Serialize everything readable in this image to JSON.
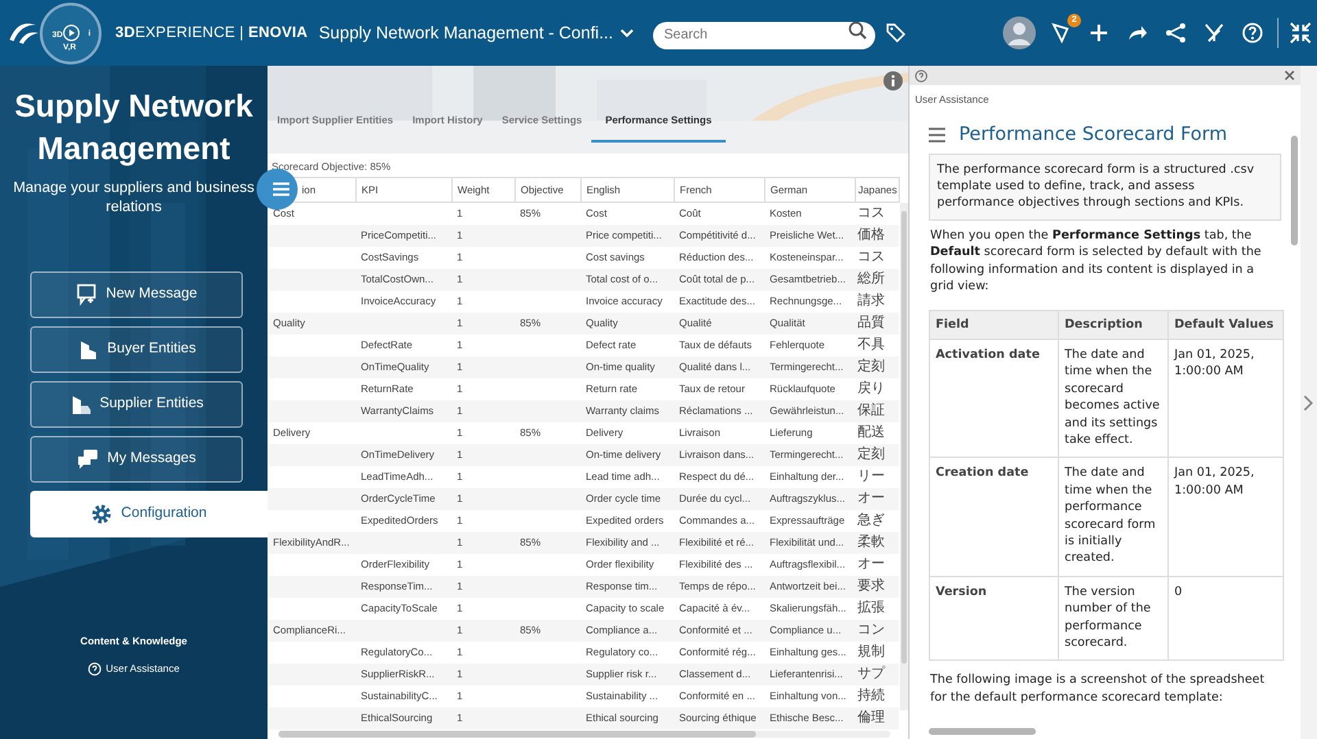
{
  "topbar": {
    "compass_labels": [
      "3D",
      "i",
      "V,R"
    ],
    "brand": "**3D**EXPERIENCE | **ENOVIA**",
    "app_title": "Supply Network Management - Confi...",
    "search": {
      "placeholder": "Search"
    },
    "notification_count": "2"
  },
  "sidebar": {
    "title": "Supply Network Management",
    "subtitle": "Manage your suppliers and business relations",
    "nav": [
      {
        "label": "New Message",
        "selected": false
      },
      {
        "label": "Buyer Entities",
        "selected": false
      },
      {
        "label": "Supplier Entities",
        "selected": false
      },
      {
        "label": "My Messages",
        "selected": false
      },
      {
        "label": "Configuration",
        "selected": true
      }
    ],
    "footer_heading": "Content & Knowledge",
    "footer_link": "User Assistance"
  },
  "tabs": [
    {
      "label": "Import Supplier Entities",
      "selected": false
    },
    {
      "label": "Import History",
      "selected": false
    },
    {
      "label": "Service Settings",
      "selected": false
    },
    {
      "label": "Performance Settings",
      "selected": true
    }
  ],
  "scorecard_objective": "Scorecard Objective: 85%",
  "table": {
    "columns": [
      "ion",
      "KPI",
      "Weight",
      "Objective",
      "English",
      "French",
      "German",
      "Japanes"
    ],
    "rows": [
      {
        "section": "Cost",
        "weight": "1",
        "objective": "85%",
        "english": "Cost",
        "french": "Coût",
        "german": "Kosten",
        "japanese": "コス"
      },
      {
        "kpi": "PriceCompetiti...",
        "weight": "1",
        "english": "Price competiti...",
        "french": "Compétitivité d...",
        "german": "Preisliche Wet...",
        "japanese": "価格"
      },
      {
        "kpi": "CostSavings",
        "weight": "1",
        "english": "Cost savings",
        "french": "Réduction des...",
        "german": "Kosteneinspar...",
        "japanese": "コス"
      },
      {
        "kpi": "TotalCostOwn...",
        "weight": "1",
        "english": "Total cost of o...",
        "french": "Coût total de p...",
        "german": "Gesamtbetrieb...",
        "japanese": "総所"
      },
      {
        "kpi": "InvoiceAccuracy",
        "weight": "1",
        "english": "Invoice accuracy",
        "french": "Exactitude des...",
        "german": "Rechnungsge...",
        "japanese": "請求"
      },
      {
        "section": "Quality",
        "weight": "1",
        "objective": "85%",
        "english": "Quality",
        "french": "Qualité",
        "german": "Qualität",
        "japanese": "品質"
      },
      {
        "kpi": "DefectRate",
        "weight": "1",
        "english": "Defect rate",
        "french": "Taux de défauts",
        "german": "Fehlerquote",
        "japanese": "不具"
      },
      {
        "kpi": "OnTimeQuality",
        "weight": "1",
        "english": "On-time quality",
        "french": "Qualité dans l...",
        "german": "Termingerecht...",
        "japanese": "定刻"
      },
      {
        "kpi": "ReturnRate",
        "weight": "1",
        "english": "Return rate",
        "french": "Taux de retour",
        "german": "Rücklaufquote",
        "japanese": "戻り"
      },
      {
        "kpi": "WarrantyClaims",
        "weight": "1",
        "english": "Warranty claims",
        "french": "Réclamations ...",
        "german": "Gewährleistun...",
        "japanese": "保証"
      },
      {
        "section": "Delivery",
        "weight": "1",
        "objective": "85%",
        "english": "Delivery",
        "french": "Livraison",
        "german": "Lieferung",
        "japanese": "配送"
      },
      {
        "kpi": "OnTimeDelivery",
        "weight": "1",
        "english": "On-time delivery",
        "french": "Livraison dans...",
        "german": "Termingerecht...",
        "japanese": "定刻"
      },
      {
        "kpi": "LeadTimeAdh...",
        "weight": "1",
        "english": "Lead time adh...",
        "french": "Respect du dé...",
        "german": "Einhaltung der...",
        "japanese": "リー"
      },
      {
        "kpi": "OrderCycleTime",
        "weight": "1",
        "english": "Order cycle time",
        "french": "Durée du cycl...",
        "german": "Auftragszyklus...",
        "japanese": "オー"
      },
      {
        "kpi": "ExpeditedOrders",
        "weight": "1",
        "english": "Expedited orders",
        "french": "Commandes a...",
        "german": "Expressaufträge",
        "japanese": "急ぎ"
      },
      {
        "section": "FlexibilityAndR...",
        "weight": "1",
        "objective": "85%",
        "english": "Flexibility and ...",
        "french": "Flexibilité et ré...",
        "german": "Flexibilität und...",
        "japanese": "柔軟"
      },
      {
        "kpi": "OrderFlexibility",
        "weight": "1",
        "english": "Order flexibility",
        "french": "Flexibilité des ...",
        "german": "Auftragsflexibil...",
        "japanese": "オー"
      },
      {
        "kpi": "ResponseTim...",
        "weight": "1",
        "english": "Response tim...",
        "french": "Temps de répo...",
        "german": "Antwortzeit bei...",
        "japanese": "要求"
      },
      {
        "kpi": "CapacityToScale",
        "weight": "1",
        "english": "Capacity to scale",
        "french": "Capacité à év...",
        "german": "Skalierungsfäh...",
        "japanese": "拡張"
      },
      {
        "section": "ComplianceRi...",
        "weight": "1",
        "objective": "85%",
        "english": "Compliance a...",
        "french": "Conformité et ...",
        "german": "Compliance u...",
        "japanese": "コン"
      },
      {
        "kpi": "RegulatoryCo...",
        "weight": "1",
        "english": "Regulatory co...",
        "french": "Conformité rég...",
        "german": "Einhaltung ges...",
        "japanese": "規制"
      },
      {
        "kpi": "SupplierRiskR...",
        "weight": "1",
        "english": "Supplier risk r...",
        "french": "Classement d...",
        "german": "Lieferantenrisi...",
        "japanese": "サプ"
      },
      {
        "kpi": "SustainabilityC...",
        "weight": "1",
        "english": "Sustainability ...",
        "french": "Conformité en ...",
        "german": "Einhaltung von...",
        "japanese": "持続"
      },
      {
        "kpi": "EthicalSourcing",
        "weight": "1",
        "english": "Ethical sourcing",
        "french": "Sourcing éthique",
        "german": "Ethische Besc...",
        "japanese": "倫理"
      }
    ]
  },
  "help": {
    "panel_label": "User Assistance",
    "title": "Performance Scorecard Form",
    "intro": "The performance scorecard form is a structured .csv template used to define, track, and assess performance objectives through sections and KPIs.",
    "paragraph": "When you open the **Performance Settings** tab, the **Default** scorecard form is selected by default with the following information and its content is displayed in a grid view:",
    "table": {
      "columns": [
        "Field",
        "Description",
        "Default Values"
      ],
      "rows": [
        [
          "Activation date",
          "The date and time when the scorecard becomes active and its settings take effect.",
          "Jan 01, 2025, 1:00:00 AM"
        ],
        [
          "Creation date",
          "The date and time when the performance scorecard form is initially created.",
          "Jan 01, 2025, 1:00:00 AM"
        ],
        [
          "Version",
          "The version number of the performance scorecard.",
          "0"
        ]
      ]
    },
    "footer": "The following image is a screenshot of the spreadsheet for the default performance scorecard template:"
  }
}
